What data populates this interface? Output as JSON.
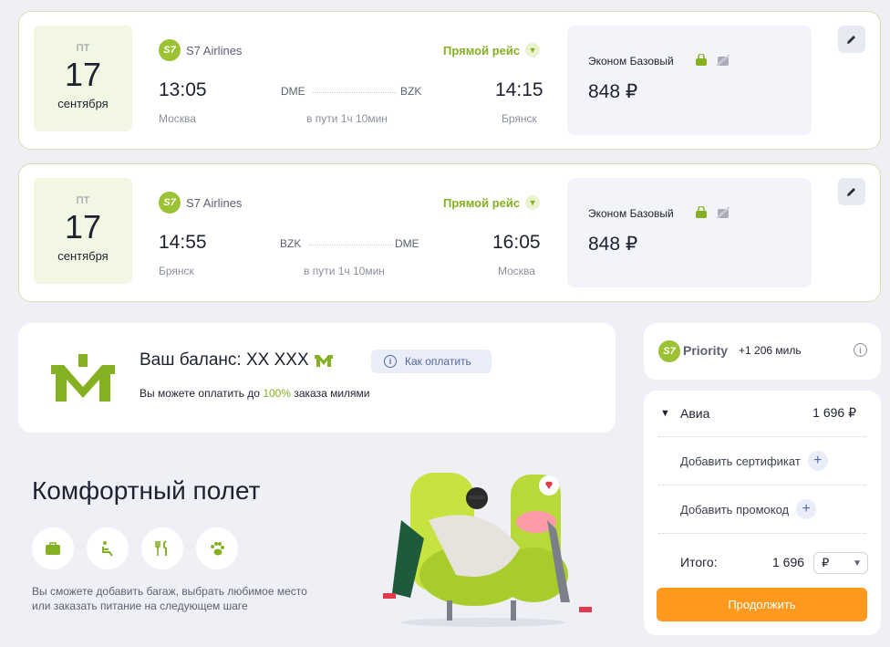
{
  "flights": [
    {
      "date": {
        "dow": "ПТ",
        "day": "17",
        "month": "сентября"
      },
      "airline": "S7 Airlines",
      "airline_logo_text": "S7",
      "direct_label": "Прямой рейс",
      "depart_time": "13:05",
      "depart_city": "Москва",
      "from_code": "DME",
      "to_code": "BZK",
      "duration": "в пути 1ч 10мин",
      "arrive_time": "14:15",
      "arrive_city": "Брянск",
      "fare_name": "Эконом Базовый",
      "price": "848 ₽"
    },
    {
      "date": {
        "dow": "ПТ",
        "day": "17",
        "month": "сентября"
      },
      "airline": "S7 Airlines",
      "airline_logo_text": "S7",
      "direct_label": "Прямой рейс",
      "depart_time": "14:55",
      "depart_city": "Брянск",
      "from_code": "BZK",
      "to_code": "DME",
      "duration": "в пути 1ч 10мин",
      "arrive_time": "16:05",
      "arrive_city": "Москва",
      "fare_name": "Эконом Базовый",
      "price": "848 ₽"
    }
  ],
  "miles": {
    "balance": "Ваш баланс: XX XXX",
    "how_to_pay": "Как оплатить",
    "pay_text_before": "Вы можете оплатить до ",
    "pay_percent": "100%",
    "pay_text_after": " заказа милями"
  },
  "comfort": {
    "title": "Комфортный полет",
    "services": [
      "baggage-icon",
      "seat-icon",
      "meal-icon",
      "pet-icon"
    ],
    "text": "Вы сможете добавить багаж, выбрать любимое место или заказать питание на следующем шаге"
  },
  "priority": {
    "logo_text": "S7",
    "name": "Priority",
    "miles": "+1 206 миль"
  },
  "summary": {
    "avia_label": "Авиа",
    "avia_amount": "1 696 ₽",
    "add_certificate": "Добавить сертификат",
    "add_promo": "Добавить промокод",
    "total_label": "Итого:",
    "total_amount": "1 696",
    "currency": "₽",
    "continue_label": "Продолжить"
  },
  "colors": {
    "brand_green": "#9bc232",
    "accent_orange": "#ff9a1f",
    "background": "#eef0f6"
  }
}
